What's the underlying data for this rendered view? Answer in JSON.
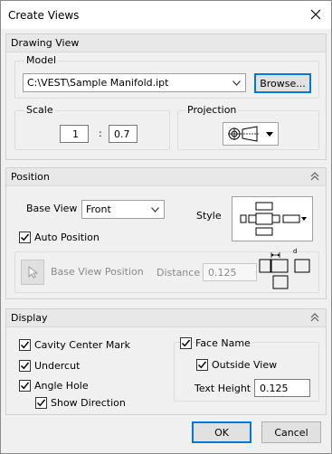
{
  "window": {
    "title": "Create Views",
    "close_icon": "close-icon"
  },
  "drawing_view": {
    "header": "Drawing View",
    "model": {
      "label": "Model",
      "value": "C:\\VEST\\Sample Manifold.ipt",
      "browse": "Browse..."
    },
    "scale": {
      "label": "Scale",
      "numerator": "1",
      "separator": ":",
      "denominator": "0.7"
    },
    "projection": {
      "label": "Projection"
    }
  },
  "position": {
    "header": "Position",
    "base_view": {
      "label": "Base View",
      "value": "Front"
    },
    "style_label": "Style",
    "auto_position": {
      "label": "Auto Position",
      "checked": true
    },
    "base_view_position": {
      "label": "Base View Position"
    },
    "distance": {
      "label": "Distance",
      "value": "0.125"
    },
    "distance_marker": "d"
  },
  "display": {
    "header": "Display",
    "cavity_center_mark": {
      "label": "Cavity Center Mark",
      "checked": true
    },
    "undercut": {
      "label": "Undercut",
      "checked": true
    },
    "angle_hole": {
      "label": "Angle Hole",
      "checked": true
    },
    "show_direction": {
      "label": "Show Direction",
      "checked": true
    },
    "face_name": {
      "label": "Face Name",
      "checked": true
    },
    "outside_view": {
      "label": "Outside View",
      "checked": true
    },
    "text_height": {
      "label": "Text Height",
      "value": "0.125"
    }
  },
  "footer": {
    "ok": "OK",
    "cancel": "Cancel"
  },
  "colors": {
    "accent": "#0078d7",
    "background": "#f0f0f0",
    "header": "#e8e8e8"
  }
}
